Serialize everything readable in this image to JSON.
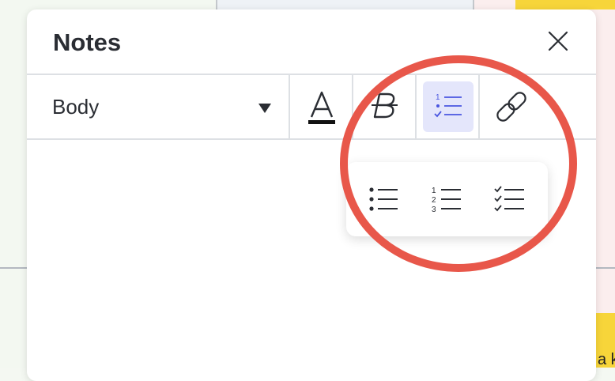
{
  "panel": {
    "title": "Notes"
  },
  "toolbar": {
    "text_style": "Body",
    "buttons": [
      {
        "icon": "text-color-icon",
        "active": false
      },
      {
        "icon": "strikethrough-icon",
        "active": false
      },
      {
        "icon": "list-icon",
        "active": true
      },
      {
        "icon": "link-icon",
        "active": false
      }
    ]
  },
  "list_menu": {
    "items": [
      {
        "icon": "bulleted-list-icon"
      },
      {
        "icon": "numbered-list-icon",
        "numbers": [
          "1",
          "2",
          "3"
        ]
      },
      {
        "icon": "checklist-icon"
      }
    ]
  },
  "canvas": {
    "sticky_text": "a k"
  },
  "colors": {
    "accent": "#4a56e0",
    "active_bg": "#e4e6fb",
    "highlight": "#e8574a",
    "sticky": "#f7d53a",
    "text": "#2a2d33"
  }
}
